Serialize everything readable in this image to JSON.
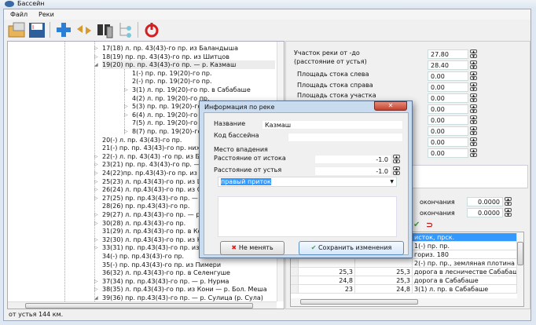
{
  "window": {
    "title": "Бассейн"
  },
  "menu": [
    "Файл",
    "Реки"
  ],
  "toolbar": [
    {
      "icon": "open-folder-icon"
    },
    {
      "icon": "save-icon"
    },
    {
      "icon": "add-icon"
    },
    {
      "icon": "move-icon"
    },
    {
      "icon": "binoculars-icon"
    },
    {
      "icon": "tree-icon"
    },
    {
      "icon": "power-icon"
    }
  ],
  "tree": {
    "items": [
      {
        "text": "17(18) л. пр. 43(43)-го пр. из Баландыша",
        "level": 1,
        "exp": "+"
      },
      {
        "text": "18(19) пр. пр. 43(43)-го пр. из Шитцов",
        "level": 1,
        "exp": "+"
      },
      {
        "text": "19(20) пр. пр. 43(43)-го пр. — р. Казмаш",
        "level": 1,
        "exp": "-",
        "selected": true
      },
      {
        "text": "1(-) пр. пр. 19(20)-го пр.",
        "level": 2
      },
      {
        "text": "2(-) пр. пр. 19(20)-го пр.",
        "level": 2
      },
      {
        "text": "3(1) л. пр. 19(20)-го пр. в Сабабаше",
        "level": 2,
        "exp": "+"
      },
      {
        "text": "4(2) л. пр. 19(20)-го пр.",
        "level": 2
      },
      {
        "text": "5(3) пр. пр. 19(20)-го пр.",
        "level": 2,
        "exp": "+"
      },
      {
        "text": "6(4) л. пр. 19(20)-го пр.",
        "level": 2,
        "exp": "+"
      },
      {
        "text": "7(5) л. пр. 19(20)-го пр.",
        "level": 2
      },
      {
        "text": "8(7) пр. пр. 19(20)-го пр. — р. Саба",
        "level": 2,
        "exp": "+"
      },
      {
        "text": "20(-) л. пр. 43(43)-го пр.",
        "level": 1
      },
      {
        "text": "21(-) пр. пр. 43(43)-го пр. ниже отм. ур. 83,5",
        "level": 1
      },
      {
        "text": "22(-) л. пр. 43(43) -го пр. из Бол. Тюлячей",
        "level": 1,
        "exp": "+"
      },
      {
        "text": "23(21) пр. пр. 43(43)-го пр. — р. Мал. Меша",
        "level": 1,
        "exp": "+"
      },
      {
        "text": "24(22)пр. пр.43(43)-го пр. из Тюлячей",
        "level": 1,
        "exp": "+"
      },
      {
        "text": "25(23) л. пр.43(43)-го пр. из Шармашей",
        "level": 1,
        "exp": "+"
      },
      {
        "text": "26(24) л. пр.43(43)-го пр. из Салаушей",
        "level": 1,
        "exp": "+"
      },
      {
        "text": "27(25) пр. пр.43(43)-го пр. — р. Тямти — Ба",
        "level": 1,
        "exp": "+"
      },
      {
        "text": "28(26) пр. пр.43(43)-го пр.",
        "level": 1
      },
      {
        "text": "29(27) л. пр.43(43)-го пр. — р.Нырса",
        "level": 1,
        "exp": "+"
      },
      {
        "text": "30(28) л. пр.43(43)-го пр.",
        "level": 1,
        "exp": "+"
      },
      {
        "text": "31(29) л. пр.43(43)-го пр. в Колкомерке",
        "level": 1
      },
      {
        "text": "32(30) л. пр.43(43)-го пр. из Кряш-Серды",
        "level": 1,
        "exp": "+"
      },
      {
        "text": "33(31) пр. пр.43(43)-го пр. из Ковалей - р. Кі",
        "level": 1,
        "exp": "+"
      },
      {
        "text": "34(-) пр. пр.43(43)-го пр.",
        "level": 1
      },
      {
        "text": "35(-) пр. пр.43(43)-го пр. из Пимери",
        "level": 1
      },
      {
        "text": "36(32) л. пр.43(43)-го пр. в Селенгуше",
        "level": 1
      },
      {
        "text": "37(34) пр. пр.43(43)-го пр. — р. Нурма",
        "level": 1,
        "exp": "+"
      },
      {
        "text": "38(35) л. пр.43(43)-го пр. из Кони — р. Бол. Меша",
        "level": 1,
        "exp": "+"
      },
      {
        "text": "39(36) пр. пр.43(43)-го пр. — р. Сулица (р. Сула)",
        "level": 1,
        "exp": "-"
      }
    ]
  },
  "status": "от устья 144 км.",
  "right": {
    "section_label": "Участок реки от -до",
    "section_sub": "(расстояние от устья)",
    "from": "27.80",
    "to": "28.40",
    "area_left_label": "Площадь стока слева",
    "area_left": "0.00",
    "area_right_label": "Площадь стока справа",
    "area_right": "0.00",
    "area_section_label": "Площадь стока участка",
    "area_section": "0.00",
    "extra_values": [
      "0.00",
      "0.00",
      "0.00",
      "0.00",
      "0.00"
    ],
    "end1_label": "окончания",
    "end1": "0.0000",
    "end2_label": "окончания",
    "end2": "0.0000",
    "table": {
      "rows": [
        {
          "a": "",
          "b": "",
          "c": "исток, прск.",
          "selected": true
        },
        {
          "a": "",
          "b": "",
          "c": "1(-) пр. пр."
        },
        {
          "a": "",
          "b": "",
          "c": "гориз. 180"
        },
        {
          "a": "",
          "b": "",
          "c": "2(-) пр. пр., земляная плотина"
        },
        {
          "a": "25,3",
          "b": "25,3",
          "c": "дорога в лесничестве Сабабаш"
        },
        {
          "a": "24,8",
          "b": "25,3",
          "c": "дорога в Сабабаше"
        },
        {
          "a": "23",
          "b": "24,8",
          "c": "3(1) л. пр. в Сабабаше"
        }
      ]
    }
  },
  "dialog": {
    "title": "Информация по реке",
    "close": "✕",
    "name_label": "Название",
    "name_value": "Казмаш",
    "code_label": "Код бассейна",
    "code_value": "",
    "mouth_label": "Место впадения",
    "from_source_label": "Расстояние от истока",
    "from_source": "-1.0",
    "from_mouth_label": "Расстояние от устья",
    "from_mouth": "-1.0",
    "side": "правый приток",
    "cancel": "Не менять",
    "save": "Сохранить изменения"
  },
  "colors": {
    "selection": "#3399ff",
    "danger": "#d42020",
    "ok": "#3aa53a"
  }
}
